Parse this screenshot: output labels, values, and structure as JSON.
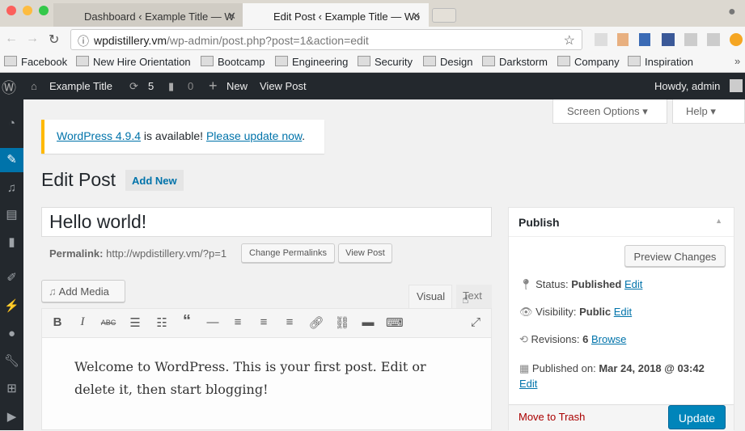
{
  "browser": {
    "tabs": [
      {
        "title": "Dashboard ‹ Example Title — W"
      },
      {
        "title": "Edit Post ‹ Example Title — Wo"
      }
    ],
    "url_host": "wpdistillery.vm",
    "url_path": "/wp-admin/post.php?post=1&action=edit",
    "bookmarks": [
      "Facebook",
      "New Hire Orientation",
      "Bootcamp",
      "Engineering",
      "Security",
      "Design",
      "Darkstorm",
      "Company",
      "Inspiration"
    ]
  },
  "adminbar": {
    "site": "Example Title",
    "updates": "5",
    "comments": "0",
    "new": "New",
    "view_post": "View Post",
    "howdy": "Howdy, admin"
  },
  "screen_options": "Screen Options",
  "help": "Help",
  "notice": {
    "version_link": "WordPress 4.9.4",
    "text": " is available! ",
    "update_link": "Please update now",
    "end": "."
  },
  "page_title": "Edit Post",
  "add_new": "Add New",
  "post": {
    "title": "Hello world!",
    "permalink_label": "Permalink:",
    "permalink": "http://wpdistillery.vm/?p=1",
    "change_permalinks": "Change Permalinks",
    "view_post": "View Post",
    "content_line1": "Welcome to WordPress. This is your first post. Edit or",
    "content_line2": "delete it, then start blogging!"
  },
  "editor": {
    "add_media": "Add Media",
    "tab_visual": "Visual",
    "tab_text": "Text"
  },
  "publish": {
    "title": "Publish",
    "preview": "Preview Changes",
    "status_label": "Status:",
    "status": "Published",
    "visibility_label": "Visibility:",
    "visibility": "Public",
    "revisions_label": "Revisions:",
    "revisions": "6",
    "browse": "Browse",
    "published_label": "Published on:",
    "published": "Mar 24, 2018 @ 03:42",
    "edit": "Edit",
    "trash": "Move to Trash",
    "update": "Update"
  }
}
